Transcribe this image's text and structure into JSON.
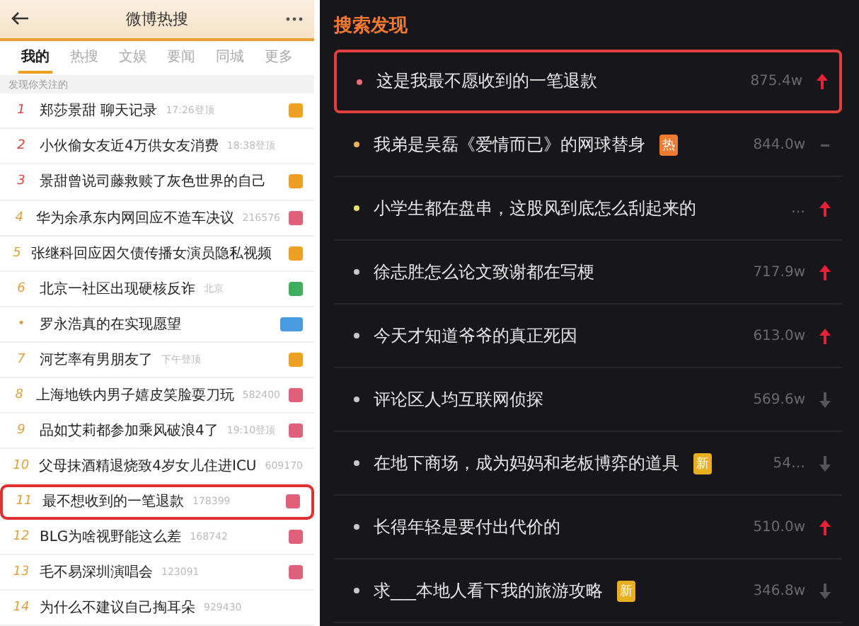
{
  "left_panel": {
    "header": {
      "title": "微博热搜"
    },
    "tabs": [
      {
        "label": "我的",
        "selected": true
      },
      {
        "label": "热搜",
        "selected": false
      },
      {
        "label": "文娱",
        "selected": false
      },
      {
        "label": "要闻",
        "selected": false
      },
      {
        "label": "同城",
        "selected": false
      },
      {
        "label": "更多",
        "selected": false
      }
    ],
    "section_label": "发现你关注的",
    "rows": [
      {
        "rank": "1",
        "title": "郑莎景甜 聊天记录",
        "meta": "17:26登顶",
        "color": "#f0a020",
        "highlighted": false
      },
      {
        "rank": "2",
        "title": "小伙偷女友近4万供女友消费",
        "meta": "18:38登顶",
        "highlighted": false
      },
      {
        "rank": "3",
        "title": "景甜曾说司藤救赎了灰色世界的自己",
        "color": "#f0a020",
        "highlighted": false
      },
      {
        "rank": "4",
        "title": "华为余承东内网回应不造车决议",
        "meta": "216576",
        "color": "#e0607a",
        "highlighted": false
      },
      {
        "rank": "5",
        "title": "张继科回应因欠债传播女演员隐私视频",
        "color": "#f0a020",
        "highlighted": false
      },
      {
        "rank": "6",
        "title": "北京一社区出现硬核反诈",
        "meta": "北京",
        "color": "#3cae5c",
        "highlighted": false
      },
      {
        "rank": "•",
        "title": "罗永浩真的在实现愿望",
        "color": "#4a9be0",
        "highlighted": false
      },
      {
        "rank": "7",
        "title": "河艺率有男朋友了",
        "meta": "下午登顶",
        "color": "#f0a020",
        "highlighted": false
      },
      {
        "rank": "8",
        "title": "上海地铁内男子嬉皮笑脸耍刀玩",
        "meta": "582400",
        "color": "#e0607a",
        "highlighted": false
      },
      {
        "rank": "9",
        "title": "品如艾莉都参加乘风破浪4了",
        "meta": "19:10登顶",
        "color": "#e0607a",
        "highlighted": false
      },
      {
        "rank": "10",
        "title": "父母抹酒精退烧致4岁女儿住进ICU",
        "meta": "609170",
        "highlighted": false
      },
      {
        "rank": "11",
        "title": "最不想收到的一笔退款",
        "meta": "178399",
        "color": "#e0607a",
        "highlighted": true
      },
      {
        "rank": "12",
        "title": "BLG为啥视野能这么差",
        "meta": "168742",
        "color": "#e0607a",
        "highlighted": false
      },
      {
        "rank": "13",
        "title": "毛不易深圳演唱会",
        "meta": "123091",
        "color": "#e0607a",
        "highlighted": false
      },
      {
        "rank": "14",
        "title": "为什么不建议自己掏耳朵",
        "meta": "929430",
        "highlighted": false
      }
    ]
  },
  "right_panel": {
    "title": "搜索发现",
    "rows": [
      {
        "title": "这是我最不愿收到的一笔退款",
        "value": "875.4w",
        "rising": true,
        "falling": false,
        "color": "#f06a78",
        "highlighted": true
      },
      {
        "title": "我弟是吴磊《爱情而已》的网球替身",
        "tag": {
          "label": "热",
          "color": "#f07a30"
        },
        "value": "844.0w",
        "rising": false,
        "falling": false,
        "color": "#f0b060",
        "highlighted": false
      },
      {
        "title": "小学生都在盘串，这股风到底怎么刮起来的",
        "value": "…",
        "rising": true,
        "falling": false,
        "color": "#e8e070",
        "highlighted": false
      },
      {
        "title": "徐志胜怎么论文致谢都在写梗",
        "value": "717.9w",
        "rising": true,
        "falling": false,
        "color": "#c8c8cc",
        "highlighted": false
      },
      {
        "title": "今天才知道爷爷的真正死因",
        "value": "613.0w",
        "rising": true,
        "falling": false,
        "color": "#c8c8cc",
        "highlighted": false
      },
      {
        "title": "评论区人均互联网侦探",
        "value": "569.6w",
        "rising": false,
        "falling": true,
        "color": "#c8c8cc",
        "highlighted": false
      },
      {
        "title": "在地下商场，成为妈妈和老板博弈的道具",
        "tag": {
          "label": "新",
          "color": "#e8b020"
        },
        "value": "54…",
        "rising": false,
        "falling": true,
        "color": "#c8c8cc",
        "highlighted": false
      },
      {
        "title": "长得年轻是要付出代价的",
        "value": "510.0w",
        "rising": true,
        "falling": false,
        "color": "#c8c8cc",
        "highlighted": false
      },
      {
        "title": "求___本地人看下我的旅游攻略",
        "tag": {
          "label": "新",
          "color": "#e8b020"
        },
        "value": "346.8w",
        "rising": false,
        "falling": true,
        "color": "#c8c8cc",
        "highlighted": false
      }
    ]
  }
}
